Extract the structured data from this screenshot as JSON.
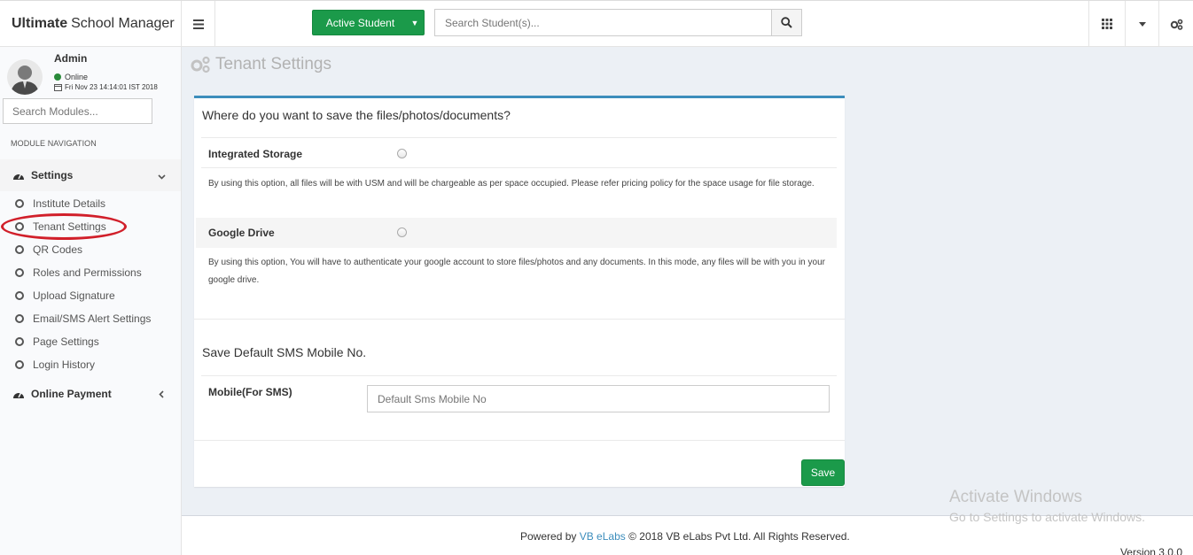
{
  "brand": {
    "bold": "Ultimate",
    "rest": "School Manager"
  },
  "topbar": {
    "active_button": "Active Student",
    "search_placeholder": "Search Student(s)..."
  },
  "user": {
    "name": "Admin",
    "status": "Online",
    "datetime": "Fri Nov 23 14:14:01 IST 2018"
  },
  "sidebar": {
    "search_placeholder": "Search Modules...",
    "section_label": "MODULE NAVIGATION",
    "settings_label": "Settings",
    "items": [
      {
        "label": "Institute Details"
      },
      {
        "label": "Tenant Settings"
      },
      {
        "label": "QR Codes"
      },
      {
        "label": "Roles and Permissions"
      },
      {
        "label": "Upload Signature"
      },
      {
        "label": "Email/SMS Alert Settings"
      },
      {
        "label": "Page Settings"
      },
      {
        "label": "Login History"
      }
    ],
    "online_payment_label": "Online Payment"
  },
  "page": {
    "title": "Tenant Settings",
    "storage_question": "Where do you want to save the files/photos/documents?",
    "integrated_label": "Integrated Storage",
    "integrated_desc": "By using this option, all files will be with USM and will be chargeable as per space occupied. Please refer pricing policy for the space usage for file storage.",
    "gdrive_label": "Google Drive",
    "gdrive_desc": "By using this option, You will have to authenticate your google account to store files/photos and any documents. In this mode, any files will be with you in your google drive.",
    "sms_title": "Save Default SMS Mobile No.",
    "mobile_label": "Mobile(For SMS)",
    "mobile_placeholder": "Default Sms Mobile No",
    "save_label": "Save"
  },
  "footer": {
    "powered_by": "Powered by",
    "company_link": "VB eLabs",
    "copyright": "© 2018 VB eLabs Pvt Ltd. All Rights Reserved.",
    "version": "Version 3.0.0"
  },
  "watermark": {
    "line1": "Activate Windows",
    "line2": "Go to Settings to activate Windows."
  },
  "colors": {
    "accent_green": "#1b9a4a",
    "box_border_blue": "#3c8dbc",
    "highlight_red": "#d11f2a"
  }
}
